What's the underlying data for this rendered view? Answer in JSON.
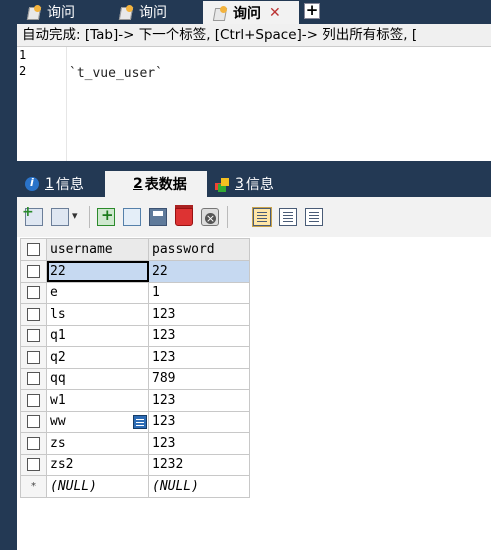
{
  "query_tabs": [
    {
      "label": "询问",
      "active": false
    },
    {
      "label": "询问",
      "active": false
    },
    {
      "label": "询问",
      "active": true
    }
  ],
  "autocomplete_hint": "自动完成: [Tab]-> 下一个标签, [Ctrl+Space]-> 列出所有标签, [",
  "editor": {
    "line_numbers": [
      "1",
      "2"
    ],
    "code": "`t_vue_user`"
  },
  "result_tabs": [
    {
      "num": "1",
      "label": "信息",
      "active": false
    },
    {
      "num": "2",
      "label": "表数据",
      "active": true
    },
    {
      "num": "3",
      "label": "信息",
      "active": false
    }
  ],
  "grid": {
    "columns": [
      "username",
      "password"
    ],
    "rows": [
      [
        "22",
        "22"
      ],
      [
        "e",
        "1"
      ],
      [
        "ls",
        "123"
      ],
      [
        "q1",
        "123"
      ],
      [
        "q2",
        "123"
      ],
      [
        "qq",
        "789"
      ],
      [
        "w1",
        "123"
      ],
      [
        "ww",
        "123"
      ],
      [
        "zs",
        "123"
      ],
      [
        "zs2",
        "1232"
      ]
    ],
    "new_row": [
      "(NULL)",
      "(NULL)"
    ],
    "new_row_marker": "*"
  },
  "colors": {
    "chrome": "#233954",
    "selection": "#c6d9f1"
  }
}
